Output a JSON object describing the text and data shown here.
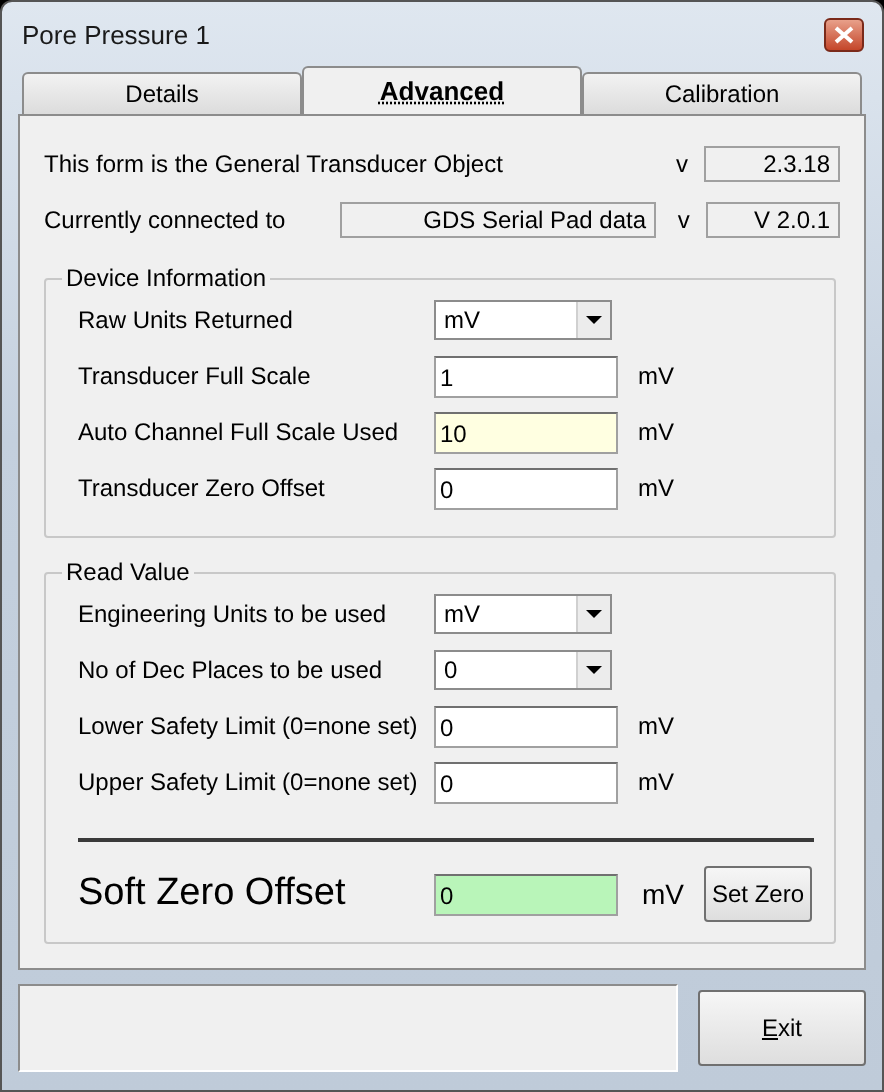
{
  "window": {
    "title": "Pore Pressure 1"
  },
  "tabs": [
    {
      "label": "Details",
      "selected": false
    },
    {
      "label": "Advanced",
      "selected": true
    },
    {
      "label": "Calibration",
      "selected": false
    }
  ],
  "info": [
    {
      "label": "This form is the General Transducer Object",
      "v": "v",
      "version": "2.3.18"
    },
    {
      "label": "Currently connected to",
      "value": "GDS Serial Pad data",
      "v": "v",
      "version": "V 2.0.1"
    }
  ],
  "device_information": {
    "title": "Device Information",
    "rows": [
      {
        "label": "Raw Units Returned",
        "kind": "select",
        "value": "mV",
        "color": "#ffffff"
      },
      {
        "label": "Transducer Full Scale",
        "kind": "text",
        "value": "1",
        "unit": "mV",
        "color": "#ffffff"
      },
      {
        "label": "Auto Channel Full Scale Used",
        "kind": "text",
        "value": "10",
        "unit": "mV",
        "color": "#ffffe1"
      },
      {
        "label": "Transducer Zero Offset",
        "kind": "text",
        "value": "0",
        "unit": "mV",
        "color": "#ffffff"
      }
    ]
  },
  "read_value": {
    "title": "Read Value",
    "rows": [
      {
        "label": "Engineering Units to be used",
        "kind": "select",
        "value": "mV",
        "color": "#ffffff"
      },
      {
        "label": "No of Dec Places to be used",
        "kind": "select",
        "value": "0",
        "color": "#ffffff"
      },
      {
        "label": "Lower Safety Limit (0=none set)",
        "kind": "text",
        "value": "0",
        "unit": "mV",
        "color": "#ffffff"
      },
      {
        "label": "Upper Safety Limit (0=none set)",
        "kind": "text",
        "value": "0",
        "unit": "mV",
        "color": "#ffffff"
      }
    ],
    "soft_zero": {
      "label": "Soft Zero Offset",
      "value": "0",
      "unit": "mV",
      "color": "#b9f5b9",
      "button": "Set Zero"
    }
  },
  "buttons": [
    "Exit"
  ]
}
